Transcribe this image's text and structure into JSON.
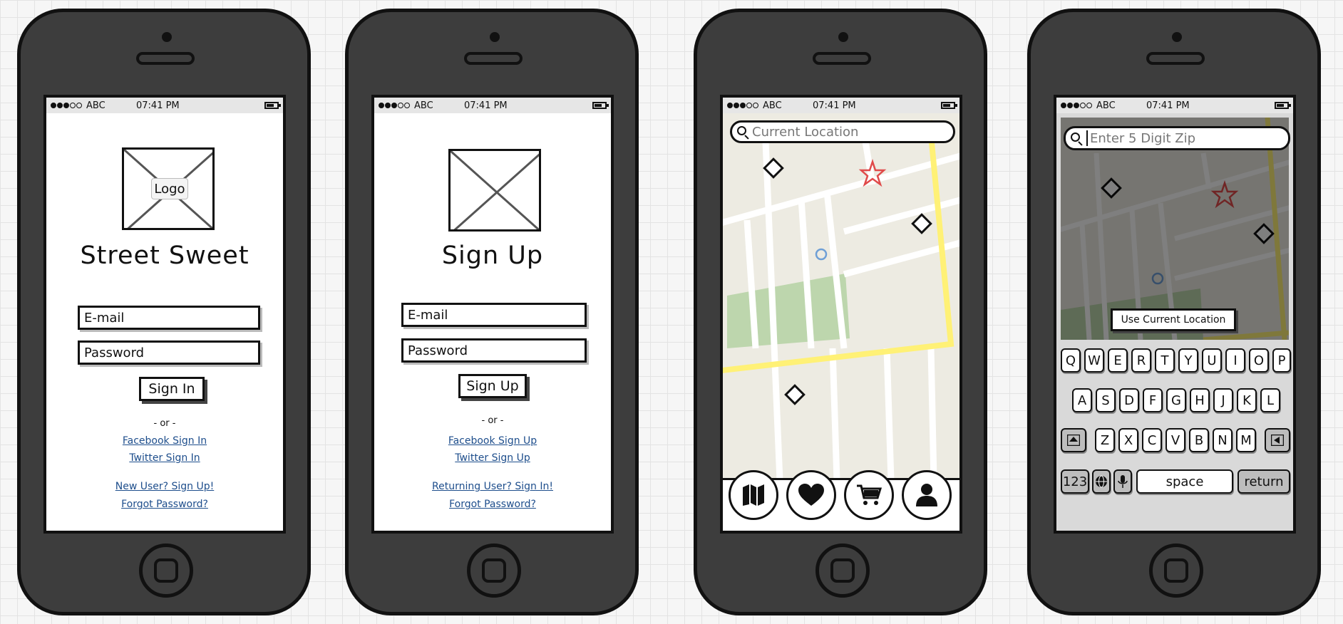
{
  "status": {
    "carrier": "ABC",
    "time": "07:41 PM"
  },
  "signin": {
    "logo_label": "Logo",
    "title": "Street Sweet",
    "email_placeholder": "E-mail",
    "password_placeholder": "Password",
    "button": "Sign In",
    "or": "- or -",
    "facebook": "Facebook Sign In",
    "twitter": "Twitter Sign In",
    "new_user": "New User?  Sign Up!",
    "forgot": "Forgot Password?"
  },
  "signup": {
    "title": "Sign Up",
    "email_placeholder": "E-mail",
    "password_placeholder": "Password",
    "button": "Sign Up",
    "or": "- or -",
    "facebook": "Facebook Sign Up",
    "twitter": "Twitter Sign Up",
    "returning": "Returning User?  Sign In!",
    "forgot": "Forgot Password?"
  },
  "mapscreen": {
    "search_placeholder": "Current Location",
    "tabs": [
      "map-icon",
      "heart-icon",
      "cart-icon",
      "user-icon"
    ]
  },
  "zipscreen": {
    "search_placeholder": "Enter 5 Digit Zip",
    "use_location": "Use Current Location",
    "keyboard": {
      "row1": [
        "Q",
        "W",
        "E",
        "R",
        "T",
        "Y",
        "U",
        "I",
        "O",
        "P"
      ],
      "row2": [
        "A",
        "S",
        "D",
        "F",
        "G",
        "H",
        "J",
        "K",
        "L"
      ],
      "row3": [
        "Z",
        "X",
        "C",
        "V",
        "B",
        "N",
        "M"
      ],
      "num": "123",
      "space": "space",
      "return": "return"
    }
  },
  "colors": {
    "map_bg": "#edebe2",
    "park": "#bdd6ad",
    "highway": "#fff176",
    "pin": "#e04a4a",
    "location": "#6e9fd6",
    "link": "#1e4e8c"
  }
}
